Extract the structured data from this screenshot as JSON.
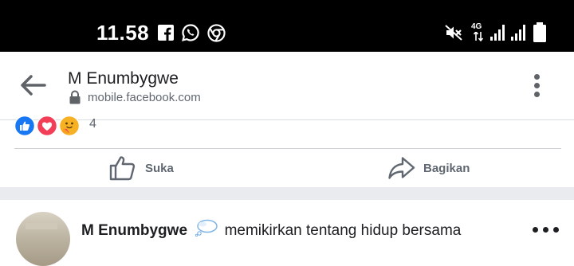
{
  "status_bar": {
    "time": "11.58",
    "left_icons": [
      "facebook-icon",
      "whatsapp-icon",
      "chrome-icon"
    ],
    "right_icons": [
      "mute-icon",
      "network-4g-icon",
      "signal-icon",
      "signal-icon",
      "battery-icon"
    ],
    "network_label": "4G"
  },
  "browser": {
    "title": "M Enumbygwe",
    "url": "mobile.facebook.com"
  },
  "post": {
    "reaction_icons": [
      "like-reaction-icon",
      "love-reaction-icon",
      "care-reaction-icon"
    ],
    "reaction_count": "4",
    "actions": {
      "like_label": "Suka",
      "share_label": "Bagikan"
    }
  },
  "next_post": {
    "author": "M Enumbygwe",
    "activity": "memikirkan tentang hidup bersama",
    "activity_icon": "thought-bubble-icon"
  },
  "colors": {
    "facebook_blue": "#1877f2",
    "love_red": "#f33e58",
    "care_yellow": "#f7b125",
    "secondary_text": "#606770"
  }
}
